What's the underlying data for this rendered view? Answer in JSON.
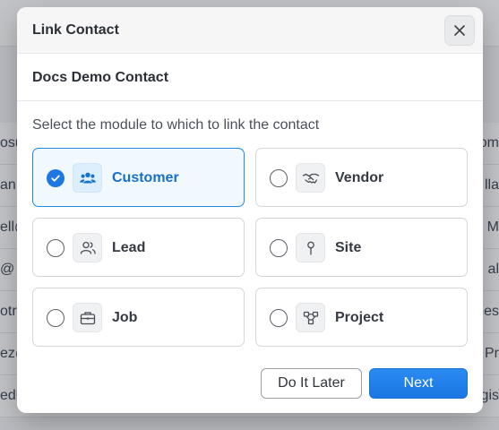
{
  "background": {
    "rows": [
      {
        "left": "osu",
        "right": "om"
      },
      {
        "left": "an@",
        "right": "lla"
      },
      {
        "left": "ell@",
        "right": "M"
      },
      {
        "left": "@",
        "right": "al"
      },
      {
        "left": "otri",
        "right": "nes"
      },
      {
        "left": "ez@",
        "right": "Pr"
      },
      {
        "left": "edh",
        "right": "gis"
      }
    ]
  },
  "modal": {
    "title": "Link Contact",
    "close_icon": "close-icon",
    "contact_name": "Docs Demo Contact",
    "instruction": "Select the module to which to link the contact",
    "options": [
      {
        "label": "Customer",
        "icon": "users-icon",
        "selected": true
      },
      {
        "label": "Vendor",
        "icon": "handshake-icon",
        "selected": false
      },
      {
        "label": "Lead",
        "icon": "user-icon",
        "selected": false
      },
      {
        "label": "Site",
        "icon": "map-pin-icon",
        "selected": false
      },
      {
        "label": "Job",
        "icon": "briefcase-icon",
        "selected": false
      },
      {
        "label": "Project",
        "icon": "project-icon",
        "selected": false
      }
    ],
    "buttons": {
      "later_label": "Do It Later",
      "next_label": "Next"
    }
  },
  "colors": {
    "accent": "#1f80ec",
    "selected_border": "#1f8ae8",
    "selected_bg": "#f1f8fe"
  }
}
